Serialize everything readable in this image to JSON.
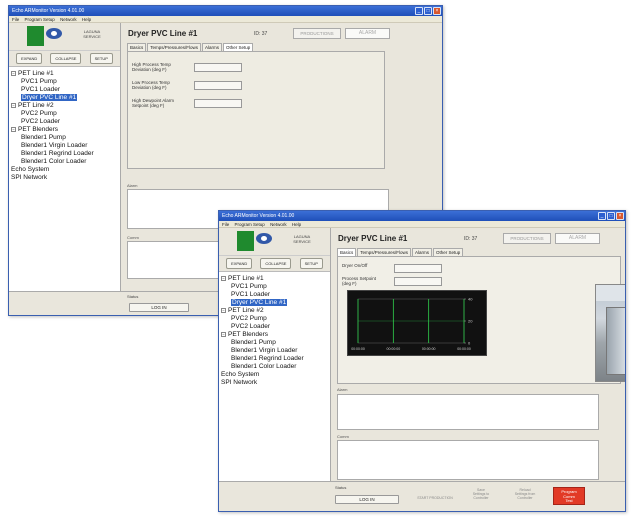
{
  "app_title": "Echo ARMonitor Version 4.01.00",
  "menu": [
    "File",
    "Program Setup",
    "Network",
    "Help"
  ],
  "logo_text": "LAGUNA\nSERVICE",
  "sidebar_buttons": [
    "EXPAND",
    "COLLAPSE",
    "SETUP"
  ],
  "tree": [
    {
      "label": "PET Line #1",
      "level": 0,
      "expander": "-"
    },
    {
      "label": "PVC1 Pump",
      "level": 1
    },
    {
      "label": "PVC1 Loader",
      "level": 1
    },
    {
      "label": "Dryer PVC Line #1",
      "level": 1,
      "selected": true
    },
    {
      "label": "PET Line #2",
      "level": 0,
      "expander": "-"
    },
    {
      "label": "PVC2 Pump",
      "level": 1
    },
    {
      "label": "PVC2 Loader",
      "level": 1
    },
    {
      "label": "PET Blenders",
      "level": 0,
      "expander": "-"
    },
    {
      "label": "Blender1 Pump",
      "level": 1
    },
    {
      "label": "Blender1 Virgin Loader",
      "level": 1
    },
    {
      "label": "Blender1 Regrind Loader",
      "level": 1
    },
    {
      "label": "Blender1 Color Loader",
      "level": 1
    },
    {
      "label": "Echo System",
      "level": 0
    },
    {
      "label": "SPI Network",
      "level": 0
    }
  ],
  "device": {
    "title": "Dryer PVC Line #1",
    "id": "ID: 37",
    "production_status": "PRODUCTIONS",
    "alarm_status": "ALARM"
  },
  "tabs": [
    "Basics",
    "Temps/Pressures/Flows",
    "Alarms",
    "Other Setup"
  ],
  "window1": {
    "active_tab": "Other Setup",
    "params": [
      "High Process Temp\nDeviation (deg F)",
      "Low Process Temp\nDeviation (deg F)",
      "High Dewpoint Alarm\nSetpoint (deg F)"
    ]
  },
  "window2": {
    "active_tab": "Basics",
    "params": [
      "Dryer On/Off",
      "Process Setpoint\n(deg F)"
    ]
  },
  "notes_label": "Alarm",
  "comments_label": "Comm",
  "bottom": {
    "status_label": "Status",
    "login_button": "LOG IN",
    "start_production": "START PRODUCTION",
    "save_button": "Save\nSettings to\nController",
    "reload_button": "Reload\nSettings from\nController",
    "program_button": "Program\nComm\nTest"
  },
  "chart_data": {
    "type": "line",
    "x": [
      "00:00:00",
      "00:00:00",
      "00:00:00",
      "00:00:00"
    ],
    "y_ticks_right": [
      "40",
      "20",
      "0"
    ],
    "series": [
      {
        "values": [
          20,
          20,
          20,
          20
        ],
        "color": "#2fd04c"
      }
    ]
  },
  "colors": {
    "title_bar": "#2554c7",
    "selection": "#3166c5",
    "program_button": "#e23a26",
    "logo_green": "#1f8a2e"
  }
}
